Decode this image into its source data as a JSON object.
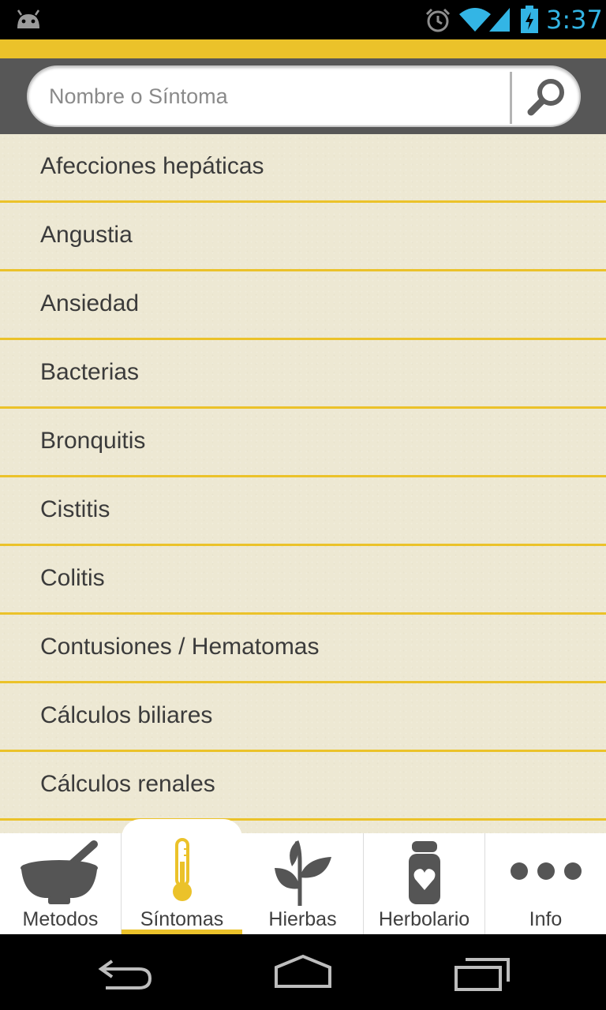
{
  "status_bar": {
    "time": "3:37",
    "icons": [
      "android-icon",
      "alarm-icon",
      "wifi-icon",
      "signal-icon",
      "battery-charging-icon"
    ],
    "clock_color": "#33b5e5"
  },
  "colors": {
    "accent": "#ebc22a",
    "header_bg": "#575757",
    "list_bg": "#ede8d3",
    "icon_gray": "#555555"
  },
  "search": {
    "placeholder": "Nombre o Síntoma",
    "value": "",
    "icon": "search-icon"
  },
  "list": {
    "items": [
      "Afecciones hepáticas",
      "Angustia",
      "Ansiedad",
      "Bacterias",
      "Bronquitis",
      "Cistitis",
      "Colitis",
      "Contusiones / Hematomas",
      "Cálculos biliares",
      "Cálculos renales"
    ]
  },
  "tabs": [
    {
      "label": "Metodos",
      "icon": "mortar-pestle-icon",
      "active": false
    },
    {
      "label": "Síntomas",
      "icon": "thermometer-icon",
      "active": true
    },
    {
      "label": "Hierbas",
      "icon": "plant-icon",
      "active": false
    },
    {
      "label": "Herbolario",
      "icon": "jar-heart-icon",
      "active": false
    },
    {
      "label": "Info",
      "icon": "more-dots-icon",
      "active": false
    }
  ],
  "nav_bar": {
    "buttons": [
      "back-icon",
      "home-icon",
      "recent-apps-icon"
    ]
  }
}
